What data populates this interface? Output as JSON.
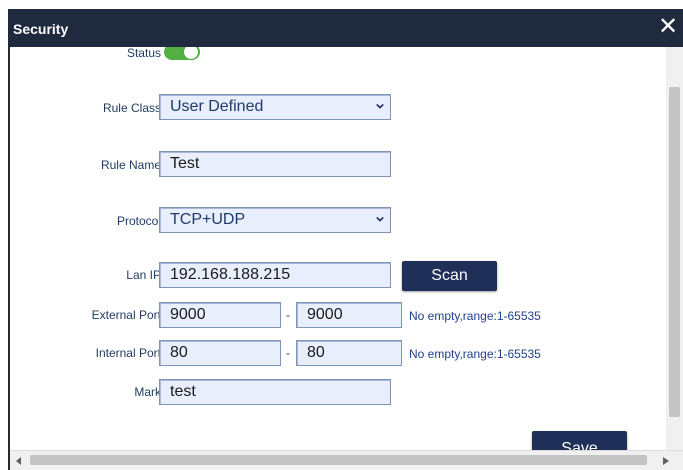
{
  "dialog": {
    "title": "Security",
    "close_glyph": "✕"
  },
  "form": {
    "status_label": "Status",
    "status_on": true,
    "rule_class_label": "Rule Class",
    "rule_class_value": "User Defined",
    "rule_name_label": "Rule Name",
    "rule_name_value": "Test",
    "protocol_label": "Protocol",
    "protocol_value": "TCP+UDP",
    "lan_ip_label": "Lan IP",
    "lan_ip_value": "192.168.188.215",
    "scan_label": "Scan",
    "external_port_label": "External Port",
    "external_port_start": "9000",
    "external_port_end": "9000",
    "external_port_hint": "No empty,range:1-65535",
    "internal_port_label": "Internal Port",
    "internal_port_start": "80",
    "internal_port_end": "80",
    "internal_port_hint": "No empty,range:1-65535",
    "mark_label": "Mark",
    "mark_value": "test",
    "range_separator": "-",
    "save_label": "Save"
  },
  "icons": {
    "close": "close-icon",
    "dropdown": "chevron-down-icon",
    "scroll_left": "scroll-left-arrow",
    "scroll_right": "scroll-right-arrow"
  },
  "colors": {
    "titlebar": "#1f2a3f",
    "field_bg": "#e8eefc",
    "button": "#1f2f58",
    "toggle_on": "#52b043",
    "hint": "#1f3f8f"
  }
}
